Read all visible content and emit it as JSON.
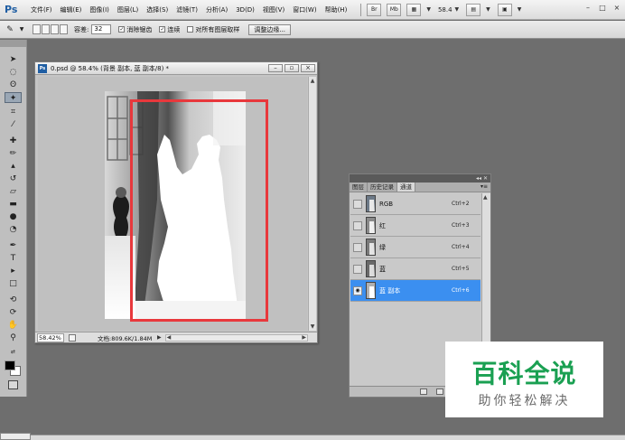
{
  "app": {
    "logo": "Ps",
    "menu": [
      "文件(F)",
      "编辑(E)",
      "图像(I)",
      "图层(L)",
      "选择(S)",
      "滤镜(T)",
      "分析(A)",
      "3D(D)",
      "视图(V)",
      "窗口(W)",
      "帮助(H)"
    ],
    "bridge_label": "Br",
    "minibridge_label": "Mb",
    "zoom_value": "58.4",
    "window_controls": [
      "–",
      "□",
      "×"
    ]
  },
  "options": {
    "tolerance_label": "容差:",
    "tolerance_value": "32",
    "antialias_label": "消除锯齿",
    "antialias_checked": true,
    "contiguous_label": "连续",
    "contiguous_checked": true,
    "sample_all_label": "对所有图层取样",
    "sample_all_checked": false,
    "refine_edge_label": "调整边缘..."
  },
  "document": {
    "badge": "Ps",
    "title": "0.psd @ 58.4% (背景 副本, 蓝 副本/8) *",
    "zoom": "58.42%",
    "info": "文档:809.6K/1.84M",
    "selection_color": "#e8383c"
  },
  "panel": {
    "tabs": [
      "图层",
      "历史记录",
      "通道"
    ],
    "active_tab": "通道",
    "channels": [
      {
        "name": "RGB",
        "shortcut": "Ctrl+2",
        "visible": false,
        "selected": false
      },
      {
        "name": "红",
        "shortcut": "Ctrl+3",
        "visible": false,
        "selected": false
      },
      {
        "name": "绿",
        "shortcut": "Ctrl+4",
        "visible": false,
        "selected": false
      },
      {
        "name": "蓝",
        "shortcut": "Ctrl+5",
        "visible": false,
        "selected": false
      },
      {
        "name": "蓝 副本",
        "shortcut": "Ctrl+6",
        "visible": true,
        "selected": true
      }
    ],
    "selected_color": "#3b8ff0"
  },
  "watermark": {
    "title": "百科全说",
    "subtitle": "助你轻松解决",
    "title_color": "#1aa052"
  }
}
